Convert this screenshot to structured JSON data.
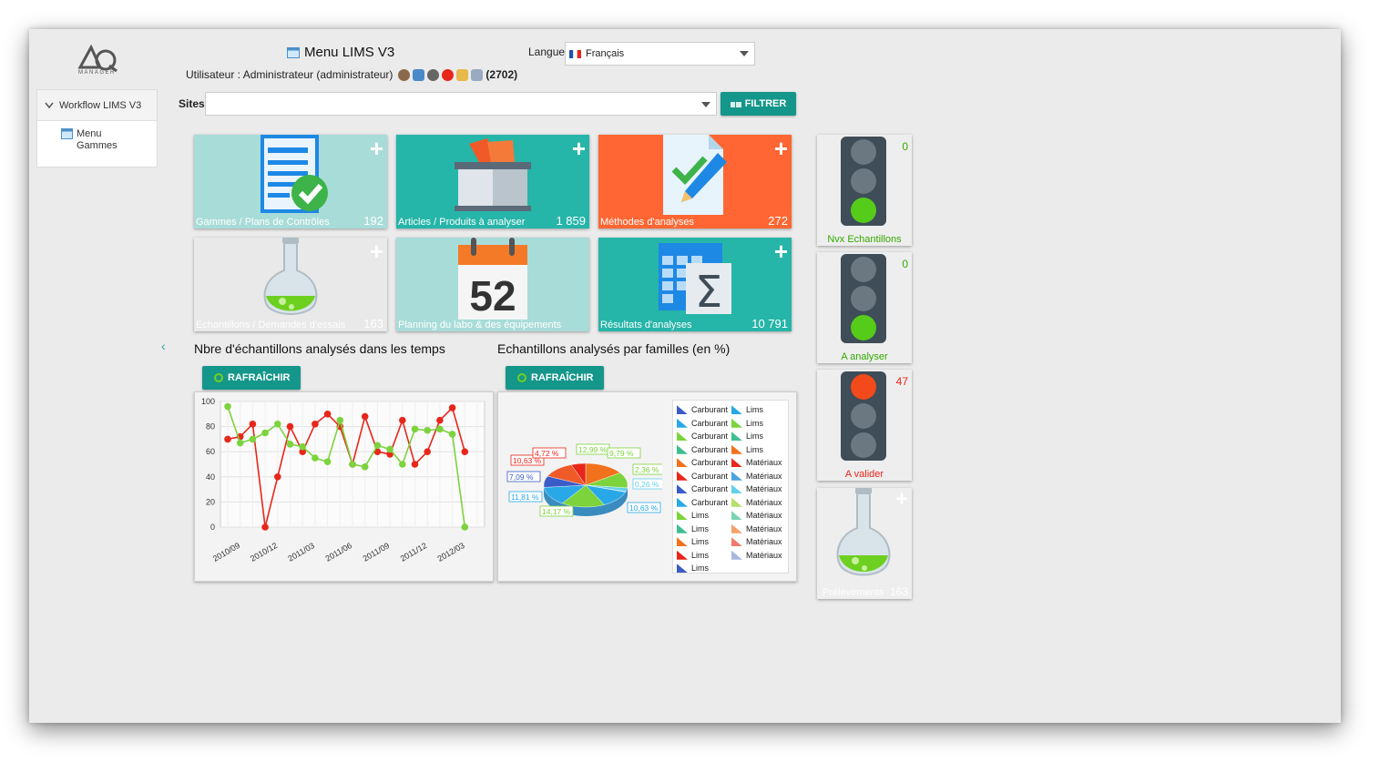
{
  "logo": {
    "subtitle": "MANAGER"
  },
  "sidebar": {
    "section_label": "Workflow LIMS V3",
    "items": [
      {
        "label": "Menu Gammes"
      }
    ]
  },
  "header": {
    "title": "Menu LIMS V3",
    "user_line": "Utilisateur : Administrateur (administrateur)",
    "user_count": "(2702)",
    "language_label": "Langue",
    "language_value": "Français",
    "sites_label": "Sites",
    "sites_value": "",
    "filter_label": "FILTRER"
  },
  "tiles": [
    {
      "label": "Gammes / Plans de Contrôles",
      "count": "192",
      "color": "#a8dcd8"
    },
    {
      "label": "Articles / Produits à analyser",
      "count": "1 859",
      "color": "#26b5a9"
    },
    {
      "label": "Méthodes d'analyses",
      "count": "272",
      "color": "#ff6633"
    },
    {
      "label": "Echantillons / Demandes d'essais",
      "count": "163",
      "color": "#e9e9e9"
    },
    {
      "label": "Planning du labo & des équipements",
      "count": "",
      "color": "#a8dcd8",
      "calendar_number": "52"
    },
    {
      "label": "Résultats d'analyses",
      "count": "10 791",
      "color": "#26b5a9"
    }
  ],
  "charts": {
    "line_title": "Nbre d'échantillons analysés dans les temps",
    "pie_title": "Echantillons analysés par familles (en %)",
    "refresh_label": "RAFRAÎCHIR"
  },
  "chart_data": [
    {
      "type": "line",
      "title": "Nbre d'échantillons analysés dans les temps",
      "x": [
        "2010/09",
        "2010/10",
        "2010/11",
        "2010/12",
        "2011/01",
        "2011/02",
        "2011/03",
        "2011/04",
        "2011/05",
        "2011/06",
        "2011/07",
        "2011/08",
        "2011/09",
        "2011/10",
        "2011/11",
        "2011/12",
        "2012/01",
        "2012/02",
        "2012/03",
        "2012/04",
        "2012/05"
      ],
      "xticks": [
        "2010/09",
        "2010/12",
        "2011/03",
        "2011/06",
        "2011/09",
        "2011/12",
        "2012/03"
      ],
      "series": [
        {
          "color": "#e8261a",
          "values": [
            70,
            72,
            82,
            0,
            40,
            80,
            60,
            82,
            90,
            80,
            50,
            88,
            60,
            58,
            85,
            50,
            60,
            85,
            95,
            60,
            null
          ]
        },
        {
          "color": "#7cd33c",
          "values": [
            96,
            67,
            70,
            75,
            82,
            66,
            64,
            55,
            52,
            85,
            50,
            48,
            65,
            62,
            50,
            78,
            77,
            78,
            74,
            0,
            null
          ]
        }
      ],
      "ylim": [
        0,
        100
      ],
      "yticks": [
        0,
        20,
        40,
        60,
        80,
        100
      ],
      "grid": true
    },
    {
      "type": "pie",
      "title": "Echantillons analysés par familles (en %)",
      "labels": [
        "12,99 %",
        "9,79 %",
        "2,36 %",
        "0,26 %",
        "10,63 %",
        "14,17 %",
        "11,81 %",
        "7,09 %",
        "10,63 %",
        "4,72 %"
      ],
      "values": [
        12.99,
        9.79,
        2.36,
        0.26,
        10.63,
        14.17,
        11.81,
        7.09,
        10.63,
        4.72
      ],
      "legend": [
        {
          "name": "Carburant",
          "color": "#3b5cc7"
        },
        {
          "name": "Carburant",
          "color": "#29a8e8"
        },
        {
          "name": "Carburant",
          "color": "#7cd33c"
        },
        {
          "name": "Carburant",
          "color": "#3fbf8f"
        },
        {
          "name": "Carburant",
          "color": "#f2711c"
        },
        {
          "name": "Carburant",
          "color": "#e8261a"
        },
        {
          "name": "Carburant",
          "color": "#3b5cc7"
        },
        {
          "name": "Carburant",
          "color": "#29a8e8"
        },
        {
          "name": "Lims",
          "color": "#7cd33c"
        },
        {
          "name": "Lims",
          "color": "#3fbf8f"
        },
        {
          "name": "Lims",
          "color": "#f2711c"
        },
        {
          "name": "Lims",
          "color": "#e8261a"
        },
        {
          "name": "Lims",
          "color": "#3b5cc7"
        },
        {
          "name": "Lims",
          "color": "#29a8e8"
        },
        {
          "name": "Lims",
          "color": "#7cd33c"
        },
        {
          "name": "Lims",
          "color": "#3fbf8f"
        },
        {
          "name": "Lims",
          "color": "#f2711c"
        },
        {
          "name": "Matériaux",
          "color": "#e8261a"
        },
        {
          "name": "Matériaux",
          "color": "#4aa3df"
        },
        {
          "name": "Matériaux",
          "color": "#62d0e8"
        },
        {
          "name": "Matériaux",
          "color": "#b5e06a"
        },
        {
          "name": "Matériaux",
          "color": "#7ad3b0"
        },
        {
          "name": "Matériaux",
          "color": "#f5a06a"
        },
        {
          "name": "Matériaux",
          "color": "#f07a6a"
        },
        {
          "name": "Matériaux",
          "color": "#a8b8e0"
        }
      ],
      "legend_placement": "right"
    }
  ],
  "status": [
    {
      "label": "Nvx Echantillons",
      "count": "0",
      "light": "green",
      "color": "#33aa00"
    },
    {
      "label": "A analyser",
      "count": "0",
      "light": "green",
      "color": "#33aa00"
    },
    {
      "label": "A valider",
      "count": "47",
      "light": "red",
      "color": "#e8261a"
    },
    {
      "label": "Prélèvements",
      "count": "163",
      "light": "flask",
      "color": "#ffffff"
    }
  ]
}
